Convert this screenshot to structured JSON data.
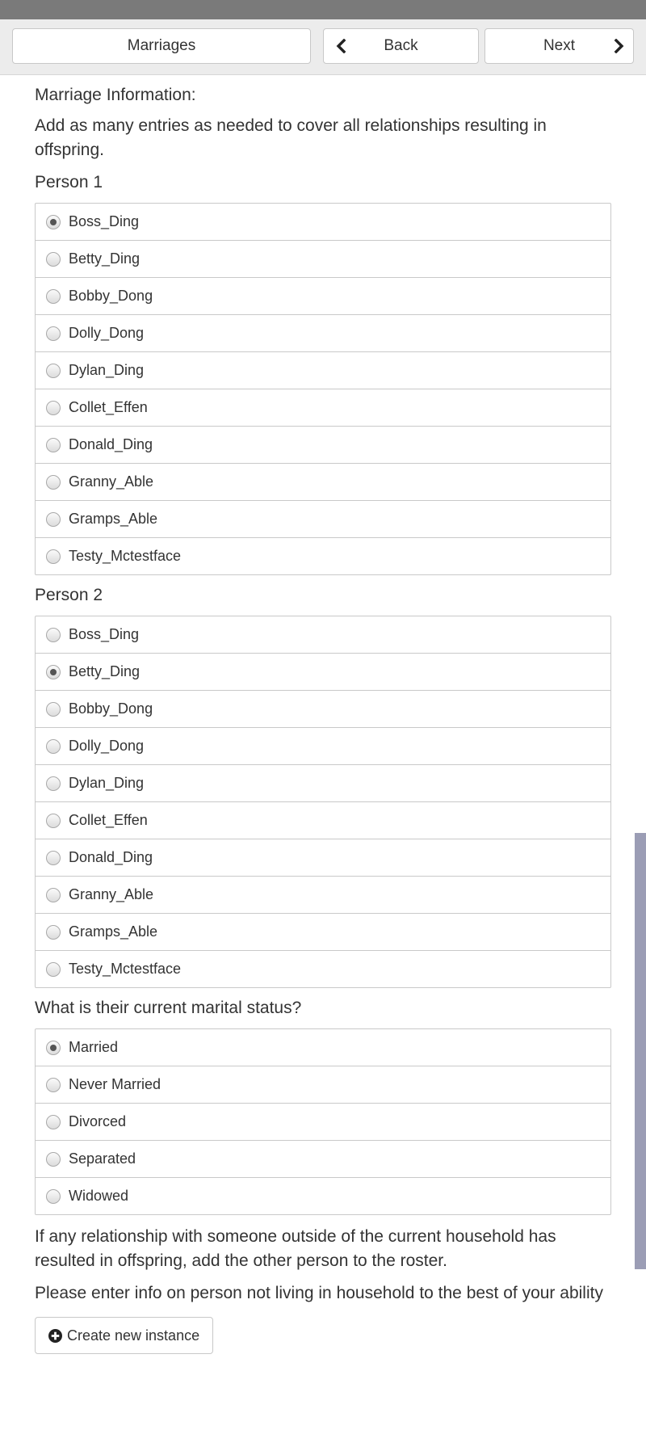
{
  "nav": {
    "section_label": "Marriages",
    "back_label": "Back",
    "next_label": "Next"
  },
  "main": {
    "heading": "Marriage Information:",
    "intro": "Add as many entries as needed to cover all relationships resulting in offspring.",
    "person1": {
      "label": "Person 1",
      "options": [
        "Boss_Ding",
        "Betty_Ding",
        "Bobby_Dong",
        "Dolly_Dong",
        "Dylan_Ding",
        "Collet_Effen",
        "Donald_Ding",
        "Granny_Able",
        "Gramps_Able",
        "Testy_Mctestface"
      ],
      "selected": "Boss_Ding"
    },
    "person2": {
      "label": "Person 2",
      "options": [
        "Boss_Ding",
        "Betty_Ding",
        "Bobby_Dong",
        "Dolly_Dong",
        "Dylan_Ding",
        "Collet_Effen",
        "Donald_Ding",
        "Granny_Able",
        "Gramps_Able",
        "Testy_Mctestface"
      ],
      "selected": "Betty_Ding"
    },
    "marital_status": {
      "label": "What is their current marital status?",
      "options": [
        "Married",
        "Never Married",
        "Divorced",
        "Separated",
        "Widowed"
      ],
      "selected": "Married"
    },
    "note1": "If any relationship with someone outside of the current household has resulted in offspring, add the other person to the roster.",
    "note2": "Please enter info on person not living in household to the best of your ability",
    "create_label": "Create new instance"
  },
  "icons": {
    "back": "chevron-left-icon",
    "next": "chevron-right-icon",
    "create": "plus-circle-icon"
  }
}
